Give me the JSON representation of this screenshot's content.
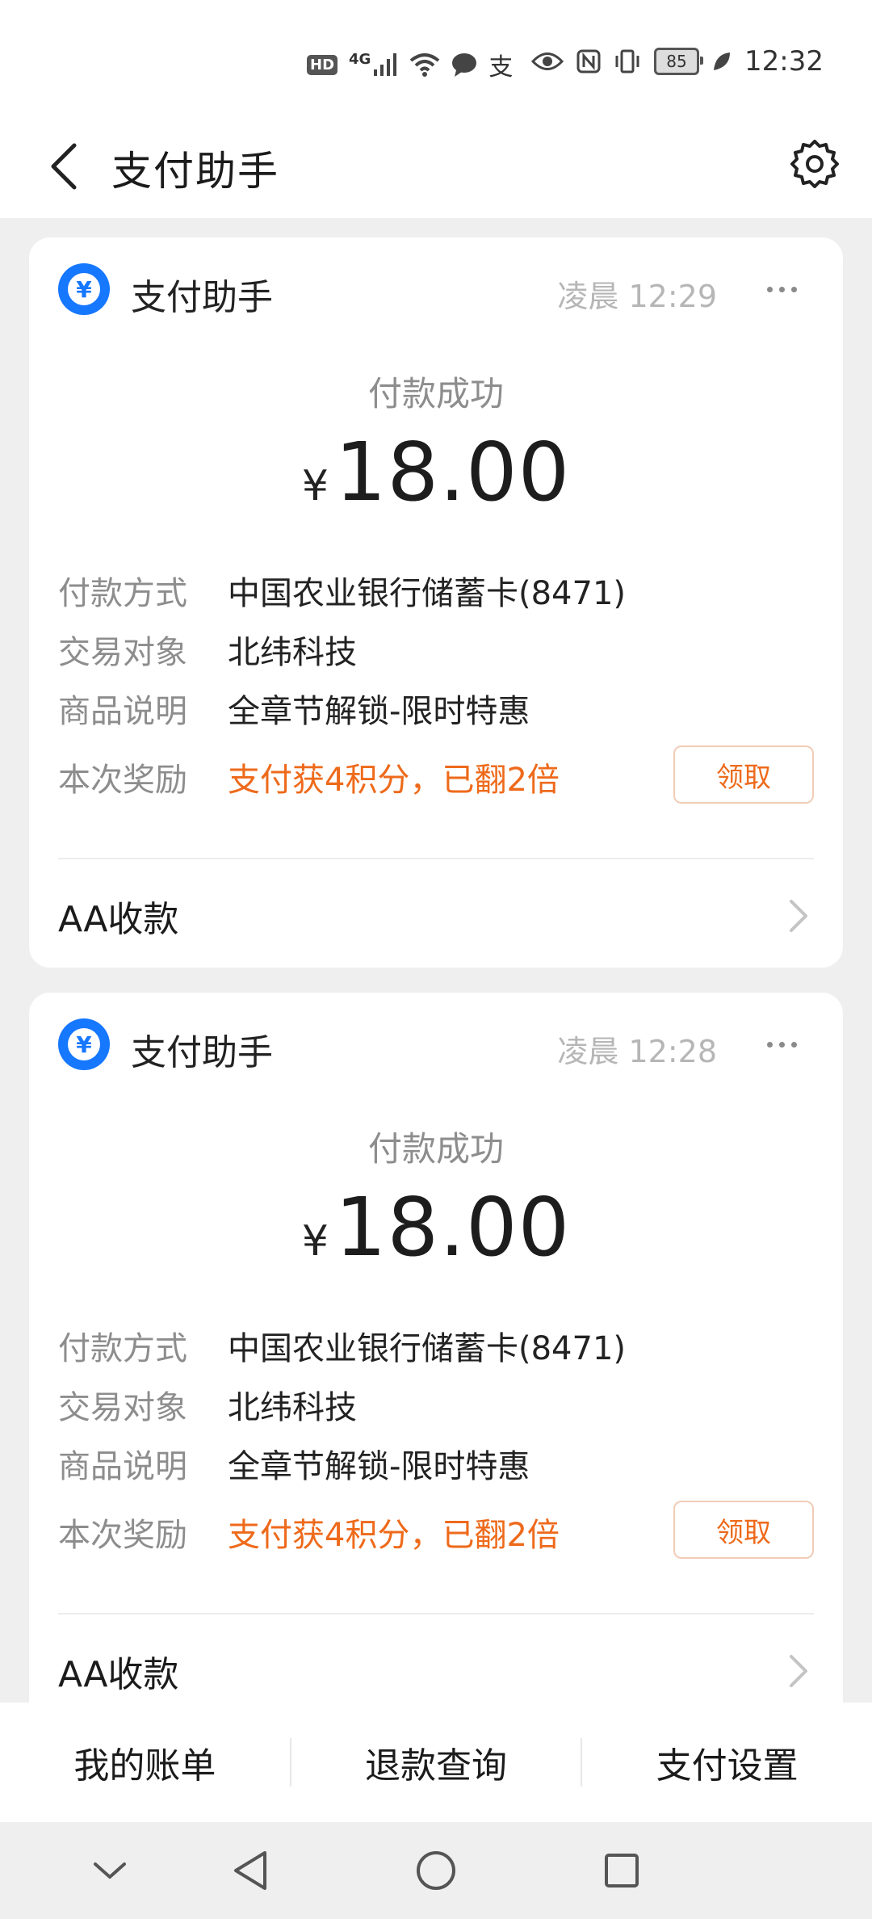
{
  "status_bar": {
    "hd": "HD",
    "network": "4G",
    "alipay_glyph": "支",
    "battery": "85",
    "time": "12:32"
  },
  "header": {
    "title": "支付助手"
  },
  "cards": [
    {
      "brand": "支付助手",
      "brand_icon": "yuan-coin-icon",
      "time": "凌晨 12:29",
      "status": "付款成功",
      "currency": "¥",
      "amount": "18.00",
      "method_label": "付款方式",
      "method_value": "中国农业银行储蓄卡(8471)",
      "payee_label": "交易对象",
      "payee_value": "北纬科技",
      "item_label": "商品说明",
      "item_value": "全章节解锁-限时特惠",
      "reward_label": "本次奖励",
      "reward_value": "支付获4积分，已翻2倍",
      "claim_label": "领取",
      "aa_label": "AA收款"
    },
    {
      "brand": "支付助手",
      "brand_icon": "yuan-coin-icon",
      "time": "凌晨 12:28",
      "status": "付款成功",
      "currency": "¥",
      "amount": "18.00",
      "method_label": "付款方式",
      "method_value": "中国农业银行储蓄卡(8471)",
      "payee_label": "交易对象",
      "payee_value": "北纬科技",
      "item_label": "商品说明",
      "item_value": "全章节解锁-限时特惠",
      "reward_label": "本次奖励",
      "reward_value": "支付获4积分，已翻2倍",
      "claim_label": "领取",
      "aa_label": "AA收款"
    }
  ],
  "bottom_tabs": [
    "我的账单",
    "退款查询",
    "支付设置"
  ],
  "colors": {
    "accent_blue": "#1677ff",
    "reward_orange": "#ee6a1b",
    "muted_text": "#8d8d8d",
    "background": "#efefef"
  }
}
